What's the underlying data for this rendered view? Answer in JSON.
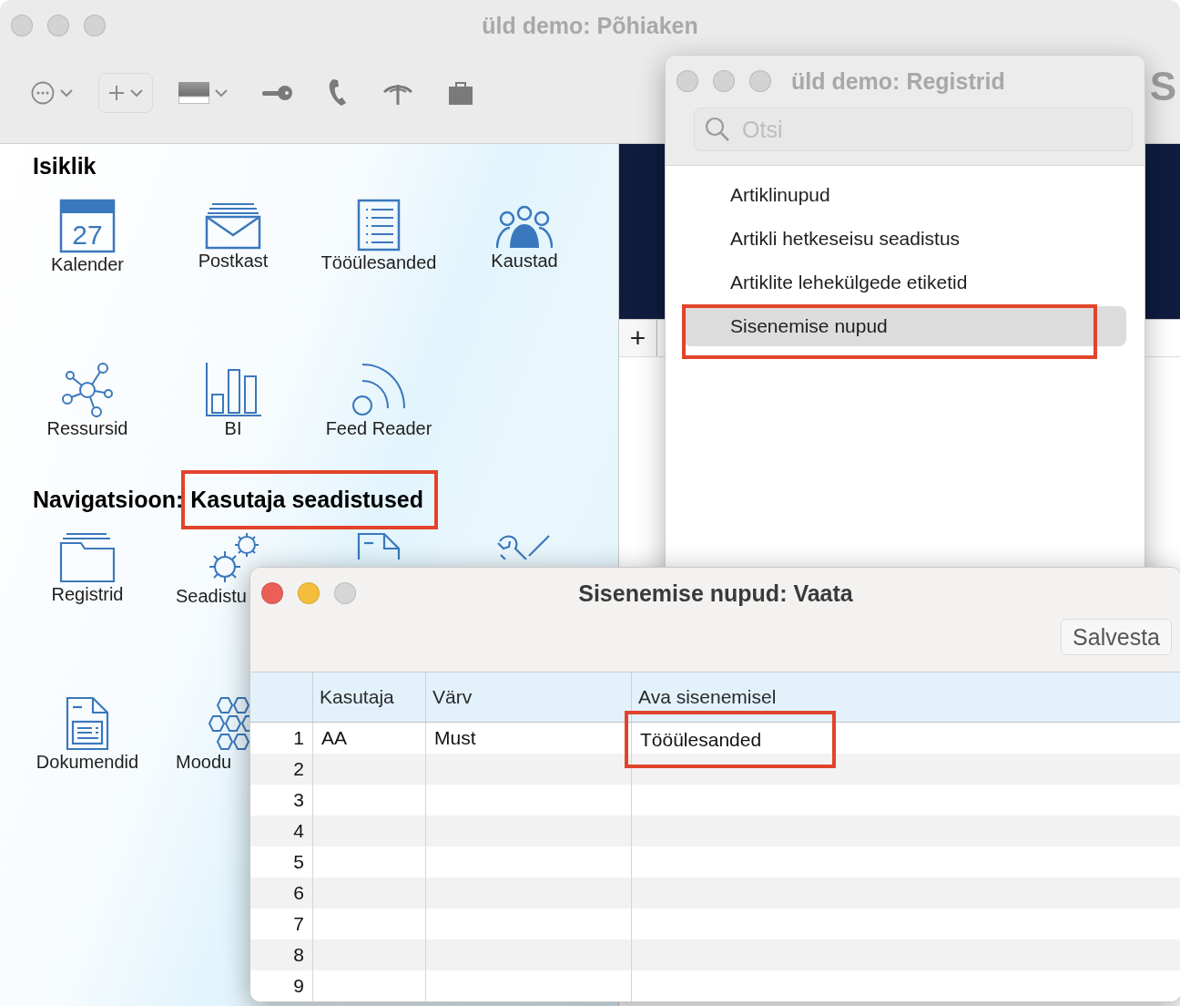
{
  "main_window": {
    "title": "üld demo: Põhiaken",
    "active": false,
    "logo_fragment": "S",
    "toolbar": [
      {
        "kind": "more",
        "dropdown": true
      },
      {
        "kind": "add",
        "dropdown": true
      },
      {
        "kind": "color",
        "dropdown": true
      },
      {
        "kind": "key"
      },
      {
        "kind": "phone"
      },
      {
        "kind": "antenna"
      },
      {
        "kind": "bag"
      }
    ],
    "sections": [
      {
        "title": "Isiklik",
        "items": [
          {
            "label": "Kalender",
            "kind": "calendar",
            "day": "27"
          },
          {
            "label": "Postkast",
            "kind": "mail"
          },
          {
            "label": "Tööülesanded",
            "kind": "list"
          },
          {
            "label": "Kaustad",
            "kind": "people"
          },
          {
            "label": "Ressursid",
            "kind": "network"
          },
          {
            "label": "BI",
            "kind": "bars"
          },
          {
            "label": "Feed Reader",
            "kind": "feed"
          }
        ]
      },
      {
        "title": "Navigatsioon:",
        "subtitle": "Kasutaja seadistused",
        "subtitle_highlighted": true,
        "items": [
          {
            "label": "Registrid",
            "kind": "folder"
          },
          {
            "label": "Seadistu",
            "kind": "gears"
          },
          {
            "kind": "document"
          },
          {
            "kind": "wrench"
          },
          {
            "label": "Dokumendid",
            "kind": "report"
          },
          {
            "label": "Moodu",
            "kind": "hexagons"
          }
        ]
      }
    ],
    "add_button": "+"
  },
  "registers_window": {
    "title": "üld demo: Registrid",
    "active": false,
    "search": {
      "placeholder": "Otsi"
    },
    "items": [
      {
        "label": "Artiklinupud",
        "selected": false,
        "highlighted": false
      },
      {
        "label": "Artikli hetkeseisu seadistus",
        "selected": false,
        "highlighted": false
      },
      {
        "label": "Artiklite lehekülgede etiketid",
        "selected": false,
        "highlighted": false
      },
      {
        "label": "Sisenemise nupud",
        "selected": true,
        "highlighted": true
      }
    ]
  },
  "record_window": {
    "title": "Sisenemise nupud: Vaata",
    "active": true,
    "save_button": "Salvesta",
    "columns": [
      "Kasutaja",
      "Värv",
      "Ava sisenemisel"
    ],
    "rows": [
      {
        "number": "1",
        "cells": [
          {
            "text": "AA",
            "highlighted": false
          },
          {
            "text": "Must",
            "highlighted": false
          },
          {
            "text": "Tööülesanded",
            "highlighted": true
          }
        ]
      },
      {
        "number": "2"
      },
      {
        "number": "3"
      },
      {
        "number": "4"
      },
      {
        "number": "5"
      },
      {
        "number": "6"
      },
      {
        "number": "7"
      },
      {
        "number": "8"
      },
      {
        "number": "9"
      }
    ]
  }
}
